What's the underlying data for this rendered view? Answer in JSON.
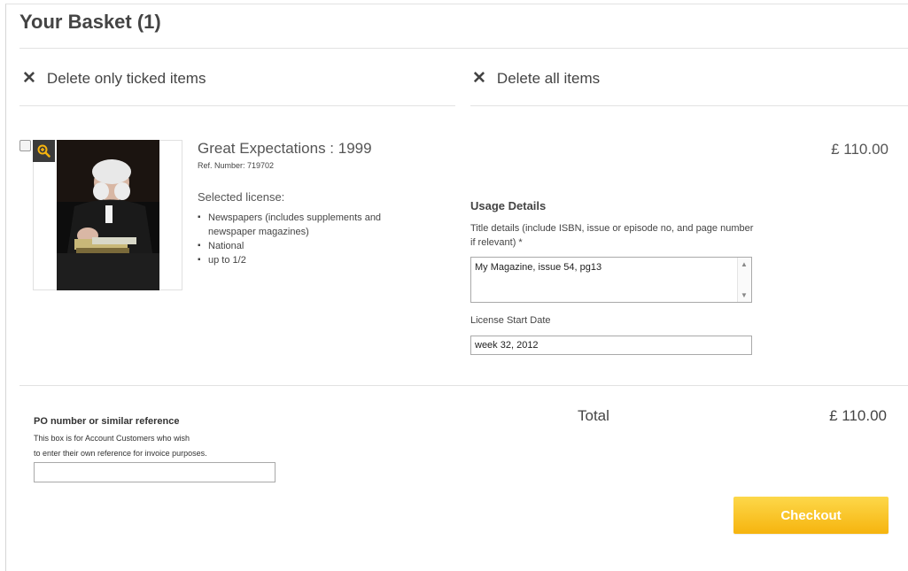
{
  "page": {
    "title": "Your Basket (1)"
  },
  "actions": {
    "delete_ticked": "Delete only ticked items",
    "delete_all": "Delete all items"
  },
  "item": {
    "title": "Great Expectations : 1999",
    "ref": "Ref. Number: 719702",
    "selected_license_label": "Selected license:",
    "license_details": [
      "Newspapers (includes supplements and newspaper magazines)",
      "National",
      "up to 1/2"
    ],
    "price": "£ 110.00",
    "checked": false
  },
  "usage": {
    "heading": "Usage Details",
    "title_details_label": "Title details (include ISBN, issue or episode no, and page number if relevant) *",
    "title_details_value": "My Magazine, issue 54, pg13",
    "start_date_label": "License Start Date",
    "start_date_value": "week 32, 2012"
  },
  "po": {
    "heading": "PO number or similar reference",
    "help_line1": "This box is for Account Customers who wish",
    "help_line2": "to enter their own reference for invoice purposes.",
    "value": ""
  },
  "summary": {
    "total_label": "Total",
    "total_value": "£ 110.00"
  },
  "checkout": {
    "label": "Checkout"
  },
  "colors": {
    "accent": "#f9c72a",
    "zoom_icon": "#f6b40e",
    "text": "#444444"
  },
  "icons": {
    "delete": "close-icon",
    "zoom": "zoom-in-icon"
  }
}
